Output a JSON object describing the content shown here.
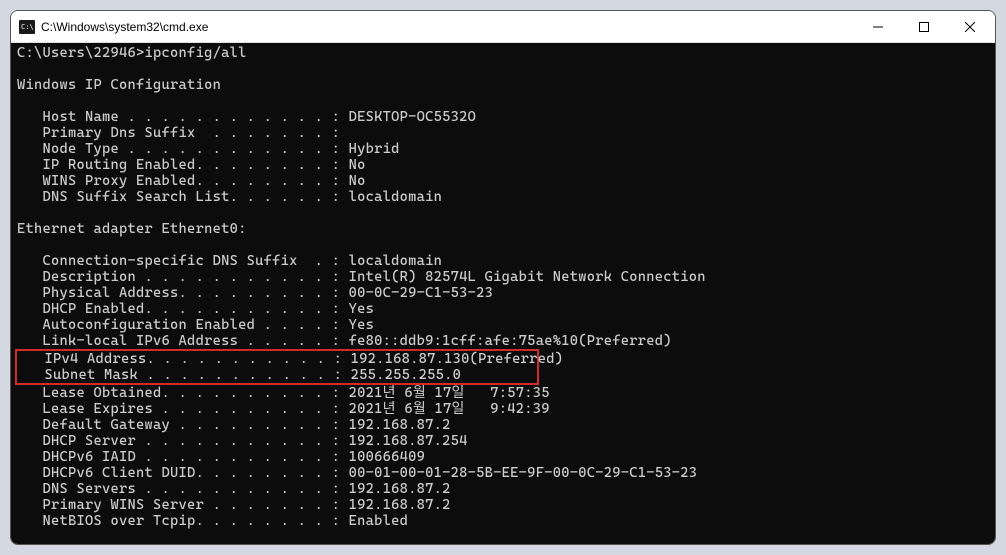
{
  "window": {
    "title": "C:\\Windows\\system32\\cmd.exe"
  },
  "terminal": {
    "prompt": "C:\\Users\\22946>ipconfig/all",
    "blank1": "",
    "header": "Windows IP Configuration",
    "blank2": "",
    "hostname": "   Host Name . . . . . . . . . . . . : DESKTOP-OC5532O",
    "primarydns": "   Primary Dns Suffix  . . . . . . . :",
    "nodetype": "   Node Type . . . . . . . . . . . . : Hybrid",
    "iprouting": "   IP Routing Enabled. . . . . . . . : No",
    "winsproxy": "   WINS Proxy Enabled. . . . . . . . : No",
    "dnssuffix": "   DNS Suffix Search List. . . . . . : localdomain",
    "blank3": "",
    "adapter": "Ethernet adapter Ethernet0:",
    "blank4": "",
    "connsuffix": "   Connection-specific DNS Suffix  . : localdomain",
    "description": "   Description . . . . . . . . . . . : Intel(R) 82574L Gigabit Network Connection",
    "physaddr": "   Physical Address. . . . . . . . . : 00-0C-29-C1-53-23",
    "dhcpenabled": "   DHCP Enabled. . . . . . . . . . . : Yes",
    "autoconfig": "   Autoconfiguration Enabled . . . . : Yes",
    "linklocal": "   Link-local IPv6 Address . . . . . : fe80::ddb9:1cff:afe:75ae%10(Preferred)",
    "ipv4": "   IPv4 Address. . . . . . . . . . . : 192.168.87.130(Preferred)",
    "subnet": "   Subnet Mask . . . . . . . . . . . : 255.255.255.0",
    "leaseobt": "   Lease Obtained. . . . . . . . . . : 2021년 6월 17일   7:57:35",
    "leaseexp": "   Lease Expires . . . . . . . . . . : 2021년 6월 17일   9:42:39",
    "gateway": "   Default Gateway . . . . . . . . . : 192.168.87.2",
    "dhcpserver": "   DHCP Server . . . . . . . . . . . : 192.168.87.254",
    "dhcpv6iaid": "   DHCPv6 IAID . . . . . . . . . . . : 100666409",
    "dhcpv6duid": "   DHCPv6 Client DUID. . . . . . . . : 00-01-00-01-28-5B-EE-9F-00-0C-29-C1-53-23",
    "dnsservers": "   DNS Servers . . . . . . . . . . . : 192.168.87.2",
    "primarywins": "   Primary WINS Server . . . . . . . : 192.168.87.2",
    "netbios": "   NetBIOS over Tcpip. . . . . . . . : Enabled"
  }
}
